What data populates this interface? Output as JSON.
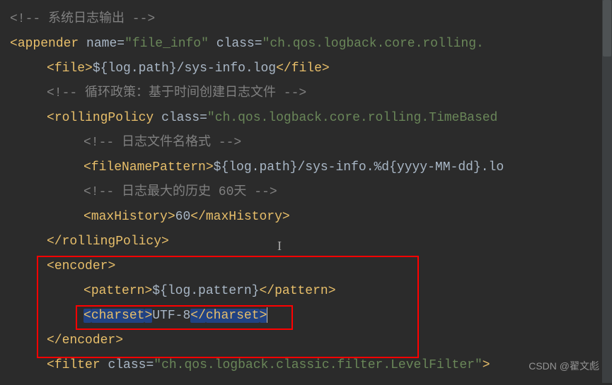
{
  "lines": {
    "l1_comment": "<!-- 系统日志输出 -->",
    "l2_attr_name": "name",
    "l2_attr_val": "\"file_info\"",
    "l2_attr_class": "class",
    "l2_class_val": "\"ch.qos.logback.core.rolling.",
    "l3_text": "${log.path}/sys-info.log",
    "l3_tag": "file",
    "l4_comment": "<!-- 循环政策：基于时间创建日志文件 -->",
    "l5_tag": "rollingPolicy",
    "l5_attr_class": "class",
    "l5_class_val": "\"ch.qos.logback.core.rolling.TimeBased",
    "l6_comment": "<!-- 日志文件名格式 -->",
    "l7_tag": "fileNamePattern",
    "l7_text": "${log.path}/sys-info.%d{yyyy-MM-dd}.lo",
    "l8_comment": "<!-- 日志最大的历史 60天 -->",
    "l9_tag": "maxHistory",
    "l9_text": "60",
    "l10_close": "rollingPolicy",
    "l11_tag": "encoder",
    "l12_tag": "pattern",
    "l12_text": "${log.pattern}",
    "l13_tag": "charset",
    "l13_text": "UTF-8",
    "l14_close": "encoder",
    "l15_tag": "filter",
    "l15_attr_class": "class",
    "l15_class_val": "\"ch.qos.logback.classic.filter.LevelFilter\""
  },
  "tags": {
    "appender": "appender",
    "lt": "<",
    "gt": ">",
    "ltc": "</"
  },
  "watermark": "CSDN @翟文彪"
}
